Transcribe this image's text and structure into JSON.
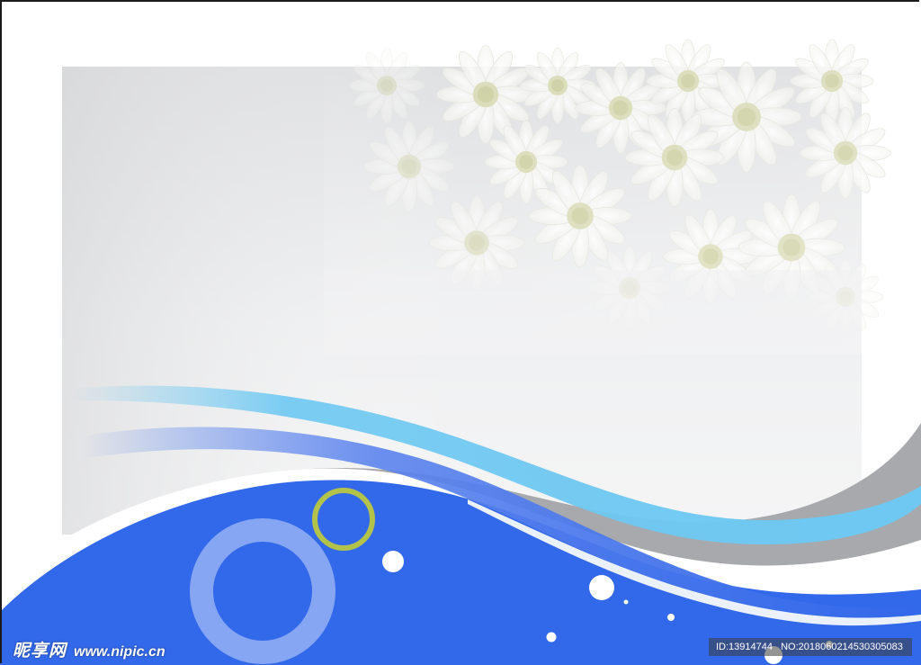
{
  "watermark": {
    "site_name": "昵享网",
    "site_url": "www.nipic.cn",
    "id_label": "ID:13914744",
    "no_label": "NO:20180602145303050​83"
  },
  "colors": {
    "primary_blue": "#3268ea",
    "light_blue": "#6ec8f2",
    "gray_band": "#a7a9ac",
    "ring_green": "#b3c24a",
    "ring_light": "#86a6f3",
    "panel_gray": "#e6e7e8"
  },
  "icons": [
    "flower-image",
    "ring-icon",
    "dot-icon"
  ]
}
